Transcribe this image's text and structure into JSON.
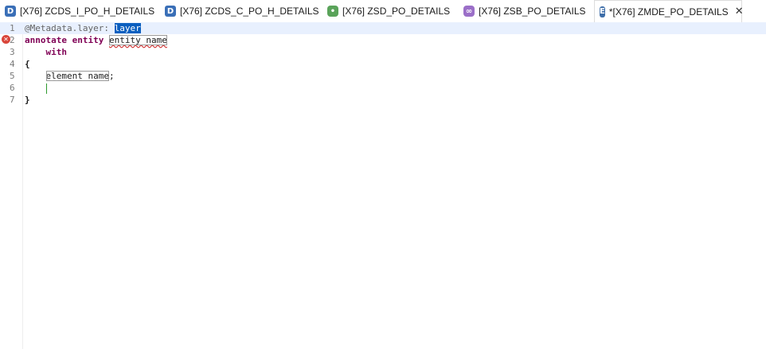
{
  "tabs": [
    {
      "label": "[X76] ZCDS_I_PO_H_DETAILS",
      "icon": "ddl-source-icon",
      "icon_letter": "D",
      "icon_color": "#3a6fb7"
    },
    {
      "label": "[X76] ZCDS_C_PO_H_DETAILS",
      "icon": "ddl-source-icon",
      "icon_letter": "D",
      "icon_color": "#3a6fb7"
    },
    {
      "label": "[X76] ZSD_PO_DETAILS",
      "icon": "service-definition-icon",
      "icon_letter": "•",
      "icon_color": "#5aa35a"
    },
    {
      "label": "[X76] ZSB_PO_DETAILS",
      "icon": "service-binding-icon",
      "icon_letter": "∞",
      "icon_color": "#9b6fc8"
    },
    {
      "label": "*[X76] ZMDE_PO_DETAILS",
      "icon": "metadata-extension-icon",
      "icon_letter": "E",
      "icon_color": "#3d6da8",
      "active": true,
      "close": "✕"
    }
  ],
  "editor": {
    "lines": [
      {
        "num": "1",
        "at": "@Metadata.layer: ",
        "selected": "layer"
      },
      {
        "num": "2",
        "kw1": "annotate",
        "kw2": "entity",
        "placeholder": "entity name",
        "error": true
      },
      {
        "num": "3",
        "indent": "    ",
        "kw": "with"
      },
      {
        "num": "4",
        "brace": "{"
      },
      {
        "num": "5",
        "indent": "    ",
        "placeholder": "element name",
        "tail": ";"
      },
      {
        "num": "6",
        "indent": "    "
      },
      {
        "num": "7",
        "brace": "}"
      }
    ]
  },
  "colors": {
    "keyword": "#7f0055",
    "selection": "#0b5fbf",
    "current_line": "#e8f0fe",
    "error": "#d9453a"
  }
}
